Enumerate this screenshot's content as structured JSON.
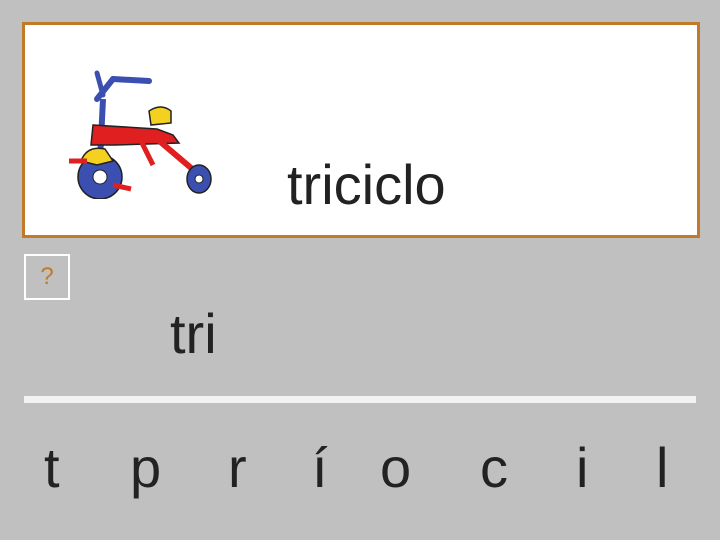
{
  "target": {
    "word": "triciclo",
    "image_icon": "tricycle-icon"
  },
  "help": {
    "label": "?"
  },
  "answer": {
    "text": "tri"
  },
  "letters": [
    "t",
    "p",
    "r",
    "í",
    "o",
    "c",
    "i",
    "l"
  ],
  "colors": {
    "background": "#c0c0c0",
    "card_border": "#c07a2a",
    "help_text": "#c07a2a",
    "divider": "#f2f2f2",
    "text": "#222222"
  }
}
